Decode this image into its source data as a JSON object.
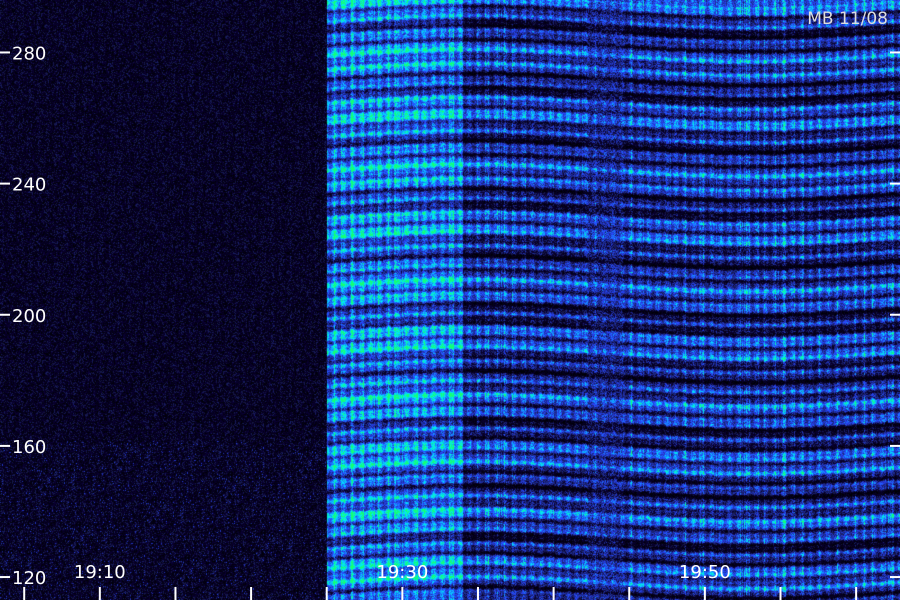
{
  "header": {
    "station_label": "MB 11/08"
  },
  "chart_data": {
    "type": "heatmap",
    "title": "",
    "xlabel": "",
    "ylabel": "",
    "ylim": [
      113,
      296
    ],
    "xlim_minutes": [
      1143.4,
      1202.9
    ],
    "yticks": [
      {
        "value": 120,
        "label": "120"
      },
      {
        "value": 160,
        "label": "160"
      },
      {
        "value": 200,
        "label": "200"
      },
      {
        "value": 240,
        "label": "240"
      },
      {
        "value": 280,
        "label": "280"
      }
    ],
    "xticks_labeled": [
      {
        "time": "19:10",
        "label": "19:10"
      },
      {
        "time": "19:30",
        "label": "19:30"
      },
      {
        "time": "19:50",
        "label": "19:50"
      }
    ],
    "xticks_minor_every_minutes": 5,
    "data_gap_end": "19:25",
    "intensity_change": "19:34",
    "colors": {
      "background": "#000000",
      "low": "#0a0030",
      "mid": "#2040ff",
      "high": "#00e0ff",
      "peak": "#20ff80",
      "axis": "#ffffff"
    }
  }
}
